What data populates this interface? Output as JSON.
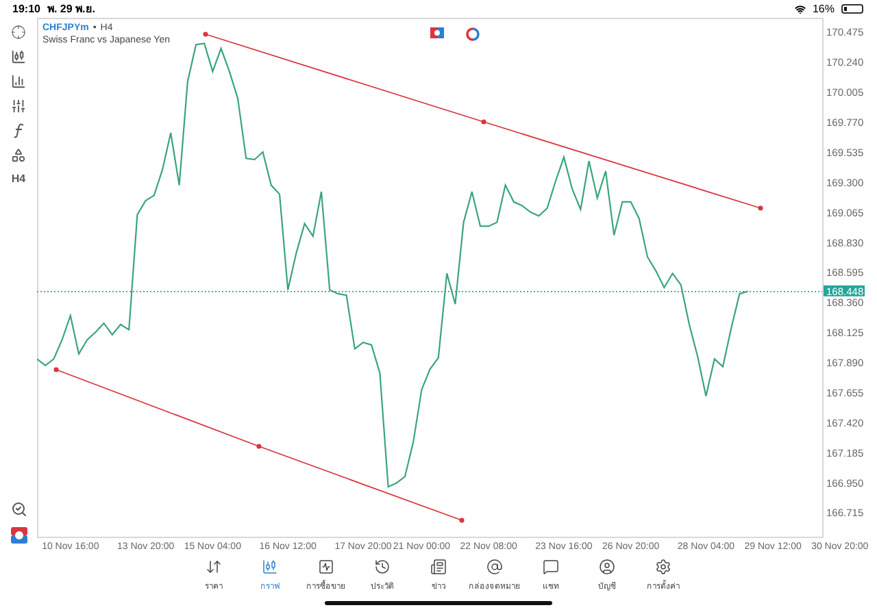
{
  "status_bar": {
    "time": "19:10",
    "date": "พ. 29 พ.ย.",
    "battery": "16%"
  },
  "toolbar": {
    "timeframe": "H4"
  },
  "chart": {
    "separator": "•",
    "timeframe": "H4",
    "description": "Swiss Franc vs Japanese Yen",
    "chart_data": {
      "type": "line",
      "ylim": [
        166.53,
        170.59
      ],
      "categories": [
        null,
        null,
        null,
        null,
        "10 Nov 16:00",
        null,
        null,
        null,
        null,
        null,
        null,
        null,
        null,
        "13 Nov 20:00",
        null,
        null,
        null,
        null,
        null,
        null,
        null,
        "15 Nov 04:00",
        null,
        null,
        null,
        null,
        null,
        null,
        null,
        null,
        "16 Nov 12:00",
        null,
        null,
        null,
        null,
        null,
        null,
        null,
        null,
        "17 Nov 20:00",
        null,
        null,
        null,
        null,
        null,
        null,
        "21 Nov 00:00",
        null,
        null,
        null,
        null,
        null,
        null,
        null,
        "22 Nov 08:00",
        null,
        null,
        null,
        null,
        null,
        null,
        null,
        null,
        "23 Nov 16:00",
        null,
        null,
        null,
        null,
        null,
        null,
        null,
        "26 Nov 20:00",
        null,
        null,
        null,
        null,
        null,
        null,
        null,
        null,
        "28 Nov 04:00",
        null,
        null,
        null,
        null,
        null,
        null,
        null,
        "29 Nov 12:00",
        null,
        null,
        null,
        null,
        null,
        null,
        null,
        "30 Nov 20:00"
      ],
      "series": [
        {
          "name": "CHFJPYm",
          "color": "#3aa57a",
          "values": [
            167.92,
            167.87,
            167.92,
            168.07,
            168.26,
            167.96,
            168.07,
            168.13,
            168.2,
            168.11,
            168.19,
            168.15,
            169.05,
            169.16,
            169.2,
            169.4,
            169.69,
            169.28,
            170.09,
            170.38,
            170.39,
            170.17,
            170.35,
            170.17,
            169.96,
            169.49,
            169.48,
            169.54,
            169.28,
            169.21,
            168.46,
            168.75,
            168.98,
            168.88,
            169.23,
            168.46,
            168.43,
            168.42,
            168.0,
            168.05,
            168.03,
            167.81,
            166.92,
            166.95,
            167.0,
            167.27,
            167.68,
            167.84,
            167.93,
            168.59,
            168.35,
            168.99,
            169.23,
            168.96,
            168.96,
            168.99,
            169.28,
            169.15,
            169.12,
            169.07,
            169.04,
            169.1,
            169.31,
            169.5,
            169.25,
            169.09,
            169.47,
            169.18,
            169.39,
            168.89,
            169.15,
            169.15,
            169.02,
            168.72,
            168.61,
            168.48,
            168.59,
            168.5,
            168.19,
            167.94,
            167.63,
            167.92,
            167.86,
            168.16,
            168.43,
            168.45,
            null,
            null,
            null,
            null,
            null,
            null,
            null,
            null,
            null,
            null,
            null
          ]
        }
      ],
      "yticks": [
        {
          "value": 170.475,
          "label": "170.475"
        },
        {
          "value": 170.24,
          "label": "170.240"
        },
        {
          "value": 170.005,
          "label": "170.005"
        },
        {
          "value": 169.77,
          "label": "169.770"
        },
        {
          "value": 169.535,
          "label": "169.535"
        },
        {
          "value": 169.3,
          "label": "169.300"
        },
        {
          "value": 169.065,
          "label": "169.065"
        },
        {
          "value": 168.83,
          "label": "168.830"
        },
        {
          "value": 168.595,
          "label": "168.595"
        },
        {
          "value": 168.36,
          "label": "168.360"
        },
        {
          "value": 168.125,
          "label": "168.125"
        },
        {
          "value": 167.89,
          "label": "167.890"
        },
        {
          "value": 167.655,
          "label": "167.655"
        },
        {
          "value": 167.42,
          "label": "167.420"
        },
        {
          "value": 167.185,
          "label": "167.185"
        },
        {
          "value": 166.95,
          "label": "166.950"
        },
        {
          "value": 166.715,
          "label": "166.715"
        }
      ],
      "ref_lines": [
        {
          "axis": "y",
          "value": 168.448,
          "label": "168.448",
          "color": "#26a69a"
        }
      ]
    }
  },
  "tabs": [
    {
      "label": "ราคา",
      "selected": false
    },
    {
      "label": "กราฟ",
      "selected": true
    },
    {
      "label": "การซื้อขาย",
      "selected": false
    },
    {
      "label": "ประวัติ",
      "selected": false
    },
    {
      "label": "ข่าว",
      "selected": false
    },
    {
      "label": "กล่องจดหมาย",
      "selected": false
    },
    {
      "label": "แชท",
      "selected": false
    },
    {
      "label": "บัญชี",
      "selected": false
    },
    {
      "label": "การตั้งค่า",
      "selected": false
    }
  ]
}
